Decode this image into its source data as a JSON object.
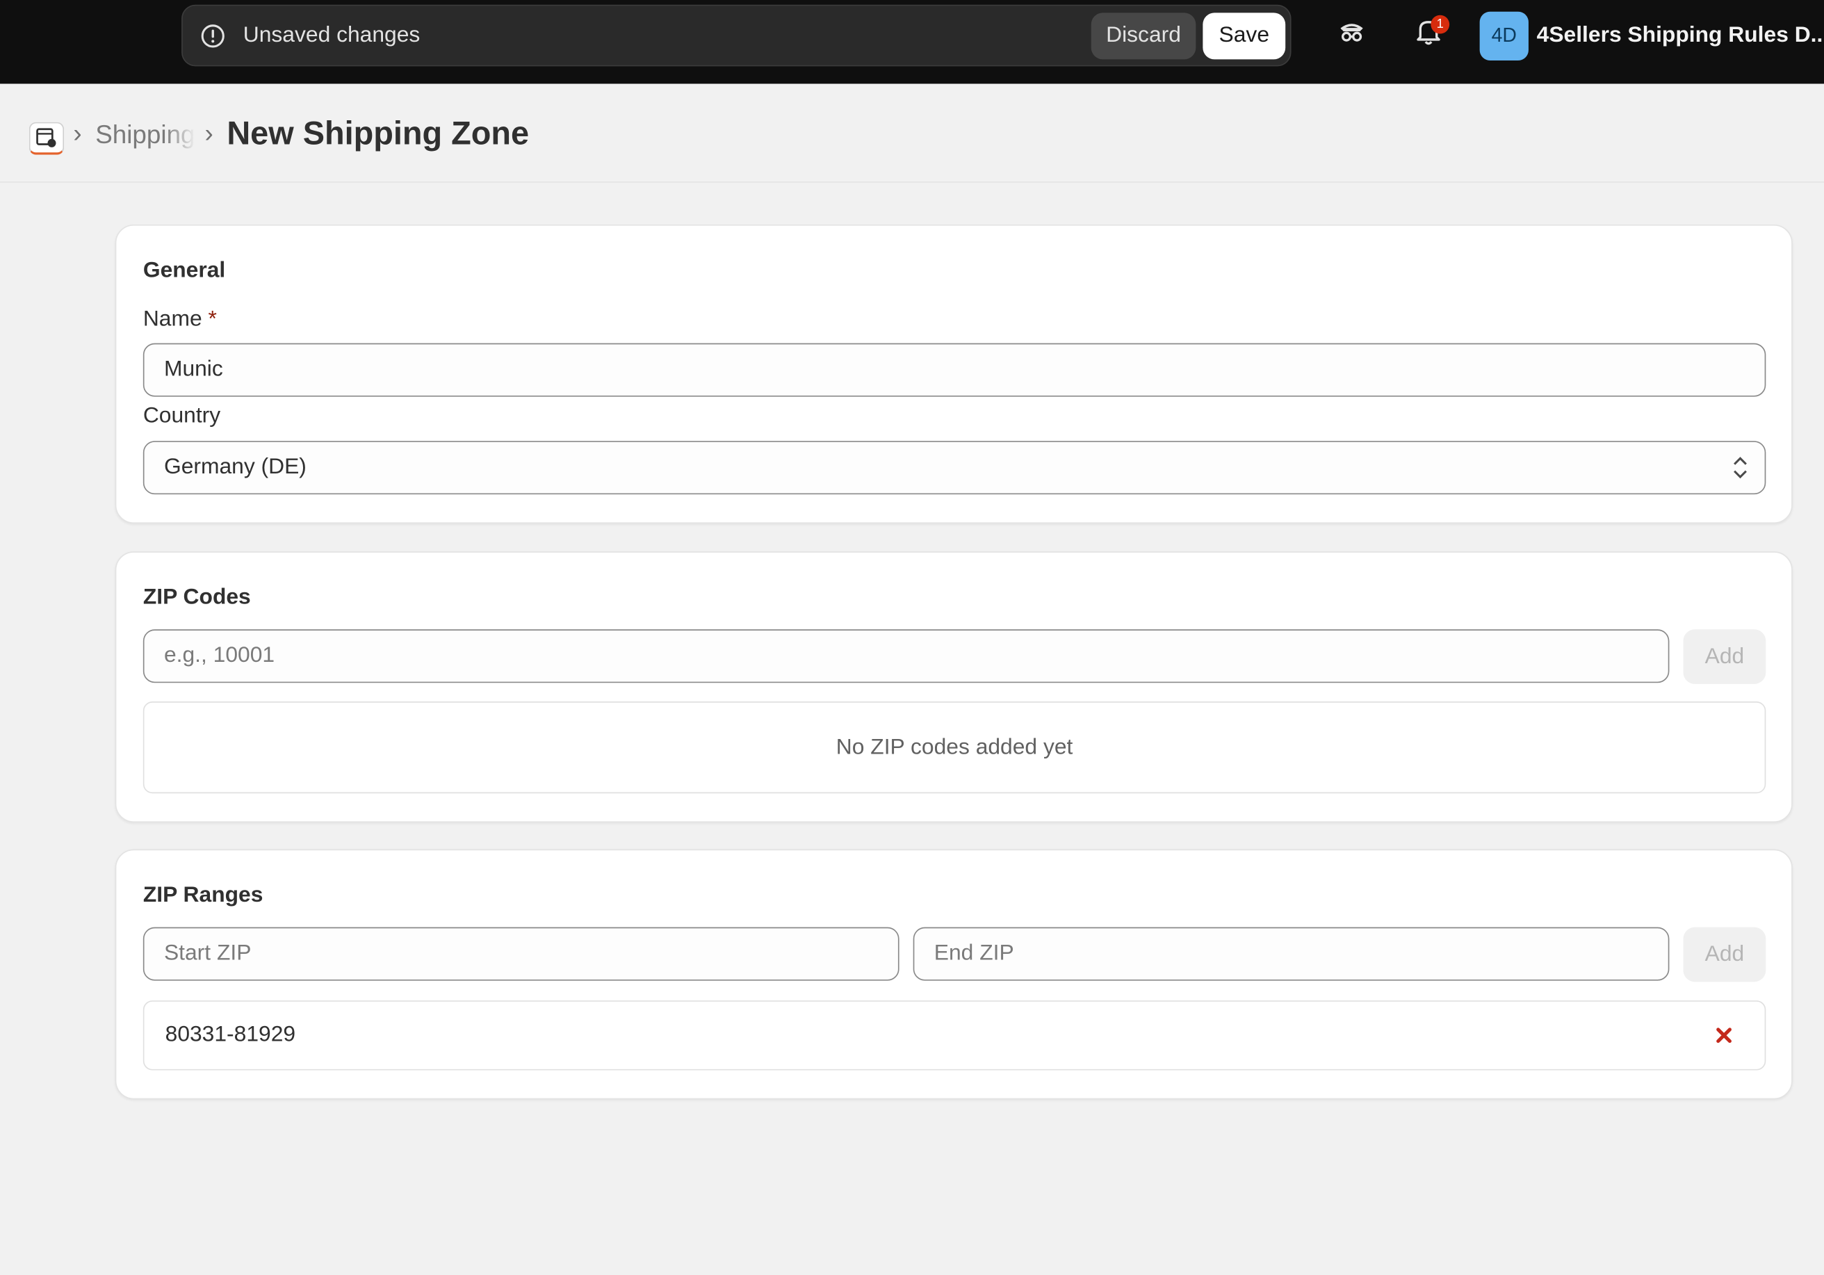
{
  "topbar": {
    "context_message": "Unsaved changes",
    "discard_label": "Discard",
    "save_label": "Save",
    "notification_count": "1",
    "avatar_initials": "4D",
    "store_name": "4Sellers Shipping Rules D..."
  },
  "breadcrumb": {
    "parent": "Shipping",
    "separator": "›",
    "title": "New Shipping Zone"
  },
  "general": {
    "title": "General",
    "name_label": "Name",
    "required_marker": "*",
    "name_value": "Munic",
    "country_label": "Country",
    "country_value": "Germany (DE)"
  },
  "zip_codes": {
    "title": "ZIP Codes",
    "input_placeholder": "e.g., 10001",
    "add_label": "Add",
    "empty_text": "No ZIP codes added yet"
  },
  "zip_ranges": {
    "title": "ZIP Ranges",
    "start_placeholder": "Start ZIP",
    "end_placeholder": "End ZIP",
    "add_label": "Add",
    "ranges": [
      "80331-81929"
    ]
  },
  "colors": {
    "topbar_bg": "#0f0f0f",
    "page_bg": "#f1f1f1",
    "avatar_bg": "#64b3ef",
    "badge": "#d72c0d",
    "remove_icon": "#c4291c"
  },
  "icons": {
    "context": "alert-circle-icon",
    "incognito": "incognito-icon",
    "notifications": "bell-icon",
    "remove": "x-icon",
    "select": "chevron-up-down-icon",
    "app": "store-app-icon"
  }
}
